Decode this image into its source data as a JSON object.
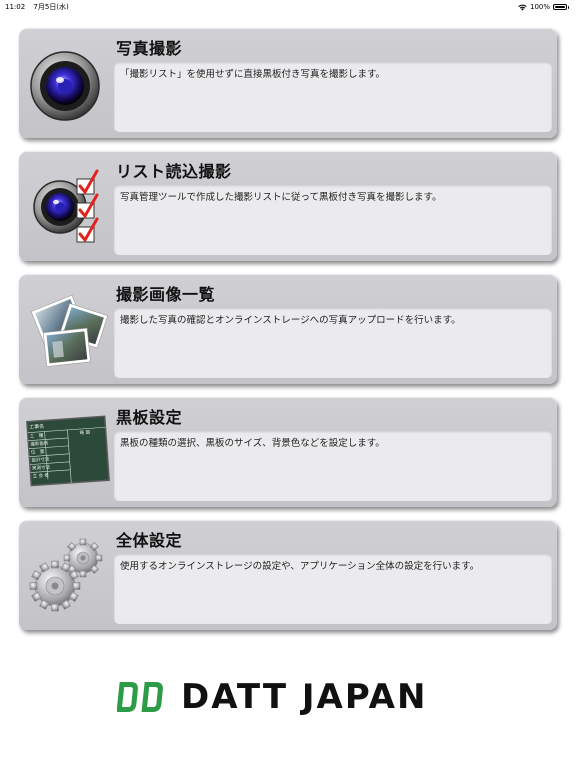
{
  "status_bar": {
    "time": "11:02",
    "date": "7月5日(水)",
    "battery": "100%"
  },
  "menu": {
    "items": [
      {
        "title": "写真撮影",
        "description": "「撮影リスト」を使用せずに直接黒板付き写真を撮影します。",
        "icon": "camera-lens-icon"
      },
      {
        "title": "リスト読込撮影",
        "description": "写真管理ツールで作成した撮影リストに従って黒板付き写真を撮影します。",
        "icon": "camera-checklist-icon"
      },
      {
        "title": "撮影画像一覧",
        "description": "撮影した写真の確認とオンラインストレージへの写真アップロードを行います。",
        "icon": "photo-stack-icon"
      },
      {
        "title": "黒板設定",
        "description": "黒板の種類の選択、黒板のサイズ、背景色などを設定します。",
        "icon": "blackboard-icon",
        "board_text": {
          "header": "工事名",
          "rows": [
            "工　種",
            "撮影箇所",
            "位　置",
            "設計寸法",
            "実測寸法",
            "立 会 者"
          ],
          "right_label": "略 図"
        }
      },
      {
        "title": "全体設定",
        "description": "使用するオンラインストレージの設定や、アプリケーション全体の設定を行います。",
        "icon": "gears-icon"
      }
    ]
  },
  "logo": {
    "text": "DATT JAPAN",
    "brand_color": "#2e9b46"
  }
}
